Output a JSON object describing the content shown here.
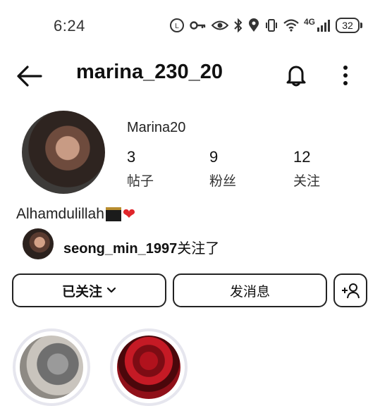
{
  "status_bar": {
    "time": "6:24",
    "network": "4G",
    "battery": "32",
    "icons": [
      "volte-icon",
      "key-icon",
      "eye-icon",
      "bluetooth-icon",
      "location-icon",
      "vibrate-icon",
      "wifi-icon",
      "signal-icon",
      "battery-icon"
    ]
  },
  "header": {
    "username": "marina_230_20",
    "icons": [
      "back-arrow-icon",
      "bell-icon",
      "more-vertical-icon"
    ]
  },
  "profile": {
    "display_name": "Marina20",
    "stats": [
      {
        "value": "3",
        "label": "帖子"
      },
      {
        "value": "9",
        "label": "粉丝"
      },
      {
        "value": "12",
        "label": "关注"
      }
    ],
    "bio_text": "Alhamdulillah",
    "bio_emojis": [
      "kaaba-emoji",
      "red-heart-emoji"
    ],
    "heart": "❤",
    "followed_by": {
      "username": "seong_min_1997",
      "suffix": "关注了"
    }
  },
  "actions": {
    "following_label": "已关注",
    "message_label": "发消息",
    "add_icon": "add-person-icon"
  },
  "highlights": [
    {
      "name": "kitten-highlight"
    },
    {
      "name": "roses-highlight"
    }
  ],
  "colors": {
    "text": "#111111",
    "heart": "#e0262b",
    "highlight_ring": "#e6e6ee"
  }
}
